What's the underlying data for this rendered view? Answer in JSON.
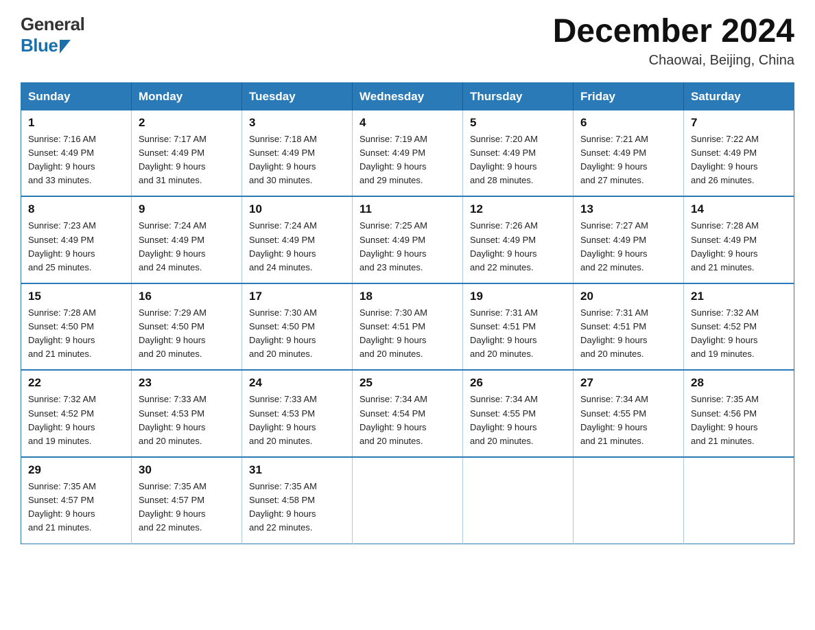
{
  "logo": {
    "general": "General",
    "blue": "Blue"
  },
  "header": {
    "title": "December 2024",
    "subtitle": "Chaowai, Beijing, China"
  },
  "calendar": {
    "days": [
      "Sunday",
      "Monday",
      "Tuesday",
      "Wednesday",
      "Thursday",
      "Friday",
      "Saturday"
    ],
    "weeks": [
      [
        {
          "date": "1",
          "sunrise": "7:16 AM",
          "sunset": "4:49 PM",
          "daylight": "9 hours and 33 minutes."
        },
        {
          "date": "2",
          "sunrise": "7:17 AM",
          "sunset": "4:49 PM",
          "daylight": "9 hours and 31 minutes."
        },
        {
          "date": "3",
          "sunrise": "7:18 AM",
          "sunset": "4:49 PM",
          "daylight": "9 hours and 30 minutes."
        },
        {
          "date": "4",
          "sunrise": "7:19 AM",
          "sunset": "4:49 PM",
          "daylight": "9 hours and 29 minutes."
        },
        {
          "date": "5",
          "sunrise": "7:20 AM",
          "sunset": "4:49 PM",
          "daylight": "9 hours and 28 minutes."
        },
        {
          "date": "6",
          "sunrise": "7:21 AM",
          "sunset": "4:49 PM",
          "daylight": "9 hours and 27 minutes."
        },
        {
          "date": "7",
          "sunrise": "7:22 AM",
          "sunset": "4:49 PM",
          "daylight": "9 hours and 26 minutes."
        }
      ],
      [
        {
          "date": "8",
          "sunrise": "7:23 AM",
          "sunset": "4:49 PM",
          "daylight": "9 hours and 25 minutes."
        },
        {
          "date": "9",
          "sunrise": "7:24 AM",
          "sunset": "4:49 PM",
          "daylight": "9 hours and 24 minutes."
        },
        {
          "date": "10",
          "sunrise": "7:24 AM",
          "sunset": "4:49 PM",
          "daylight": "9 hours and 24 minutes."
        },
        {
          "date": "11",
          "sunrise": "7:25 AM",
          "sunset": "4:49 PM",
          "daylight": "9 hours and 23 minutes."
        },
        {
          "date": "12",
          "sunrise": "7:26 AM",
          "sunset": "4:49 PM",
          "daylight": "9 hours and 22 minutes."
        },
        {
          "date": "13",
          "sunrise": "7:27 AM",
          "sunset": "4:49 PM",
          "daylight": "9 hours and 22 minutes."
        },
        {
          "date": "14",
          "sunrise": "7:28 AM",
          "sunset": "4:49 PM",
          "daylight": "9 hours and 21 minutes."
        }
      ],
      [
        {
          "date": "15",
          "sunrise": "7:28 AM",
          "sunset": "4:50 PM",
          "daylight": "9 hours and 21 minutes."
        },
        {
          "date": "16",
          "sunrise": "7:29 AM",
          "sunset": "4:50 PM",
          "daylight": "9 hours and 20 minutes."
        },
        {
          "date": "17",
          "sunrise": "7:30 AM",
          "sunset": "4:50 PM",
          "daylight": "9 hours and 20 minutes."
        },
        {
          "date": "18",
          "sunrise": "7:30 AM",
          "sunset": "4:51 PM",
          "daylight": "9 hours and 20 minutes."
        },
        {
          "date": "19",
          "sunrise": "7:31 AM",
          "sunset": "4:51 PM",
          "daylight": "9 hours and 20 minutes."
        },
        {
          "date": "20",
          "sunrise": "7:31 AM",
          "sunset": "4:51 PM",
          "daylight": "9 hours and 20 minutes."
        },
        {
          "date": "21",
          "sunrise": "7:32 AM",
          "sunset": "4:52 PM",
          "daylight": "9 hours and 19 minutes."
        }
      ],
      [
        {
          "date": "22",
          "sunrise": "7:32 AM",
          "sunset": "4:52 PM",
          "daylight": "9 hours and 19 minutes."
        },
        {
          "date": "23",
          "sunrise": "7:33 AM",
          "sunset": "4:53 PM",
          "daylight": "9 hours and 20 minutes."
        },
        {
          "date": "24",
          "sunrise": "7:33 AM",
          "sunset": "4:53 PM",
          "daylight": "9 hours and 20 minutes."
        },
        {
          "date": "25",
          "sunrise": "7:34 AM",
          "sunset": "4:54 PM",
          "daylight": "9 hours and 20 minutes."
        },
        {
          "date": "26",
          "sunrise": "7:34 AM",
          "sunset": "4:55 PM",
          "daylight": "9 hours and 20 minutes."
        },
        {
          "date": "27",
          "sunrise": "7:34 AM",
          "sunset": "4:55 PM",
          "daylight": "9 hours and 21 minutes."
        },
        {
          "date": "28",
          "sunrise": "7:35 AM",
          "sunset": "4:56 PM",
          "daylight": "9 hours and 21 minutes."
        }
      ],
      [
        {
          "date": "29",
          "sunrise": "7:35 AM",
          "sunset": "4:57 PM",
          "daylight": "9 hours and 21 minutes."
        },
        {
          "date": "30",
          "sunrise": "7:35 AM",
          "sunset": "4:57 PM",
          "daylight": "9 hours and 22 minutes."
        },
        {
          "date": "31",
          "sunrise": "7:35 AM",
          "sunset": "4:58 PM",
          "daylight": "9 hours and 22 minutes."
        },
        null,
        null,
        null,
        null
      ]
    ],
    "labels": {
      "sunrise": "Sunrise:",
      "sunset": "Sunset:",
      "daylight": "Daylight:"
    }
  }
}
